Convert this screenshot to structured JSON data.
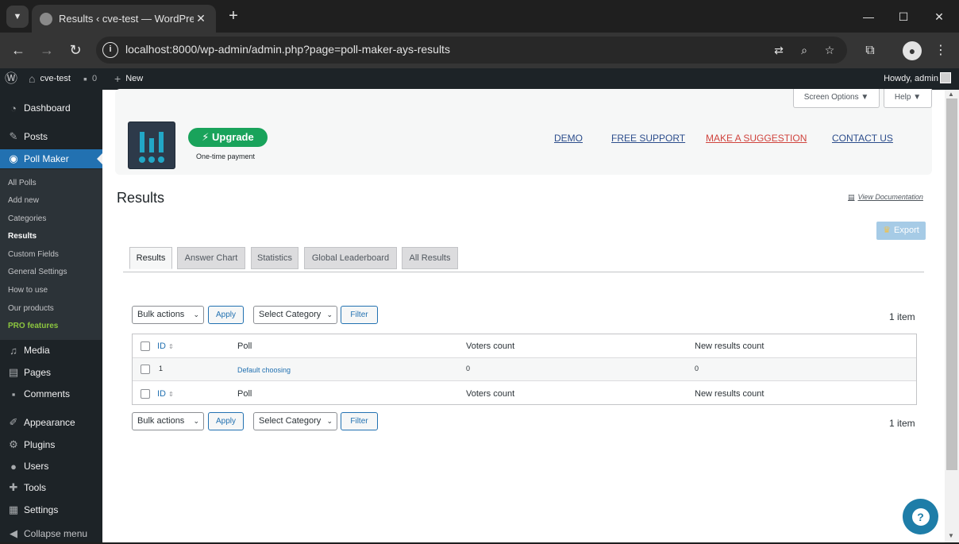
{
  "browser": {
    "tab_title": "Results ‹ cve-test — WordPress",
    "url": "localhost:8000/wp-admin/admin.php?page=poll-maker-ays-results"
  },
  "adminbar": {
    "site_name": "cve-test",
    "comments_count": "0",
    "new_label": "New",
    "howdy": "Howdy, admin"
  },
  "sidebar": {
    "dashboard": "Dashboard",
    "posts": "Posts",
    "poll_maker": "Poll Maker",
    "submenu": [
      "All Polls",
      "Add new",
      "Categories",
      "Results",
      "Custom Fields",
      "General Settings",
      "How to use",
      "Our products",
      "PRO features"
    ],
    "media": "Media",
    "pages": "Pages",
    "comments": "Comments",
    "appearance": "Appearance",
    "plugins": "Plugins",
    "users": "Users",
    "tools": "Tools",
    "settings": "Settings",
    "collapse": "Collapse menu"
  },
  "screen_options": {
    "screen": "Screen Options ▼",
    "help": "Help ▼"
  },
  "header": {
    "upgrade": "⚡ Upgrade",
    "one_time": "One-time payment",
    "links": [
      "DEMO",
      "FREE SUPPORT",
      "MAKE A SUGGESTION",
      "CONTACT US"
    ]
  },
  "page": {
    "title": "Results",
    "view_doc": "View Documentation",
    "export": "Export"
  },
  "tabs": [
    "Results",
    "Answer Chart",
    "Statistics",
    "Global Leaderboard",
    "All Results"
  ],
  "filters": {
    "bulk_actions": "Bulk actions",
    "apply": "Apply",
    "select_category": "Select Category",
    "filter": "Filter",
    "items": "1 item"
  },
  "table": {
    "headers": [
      "ID",
      "Poll",
      "Voters count",
      "New results count"
    ],
    "rows": [
      {
        "id": "1",
        "poll": "Default choosing",
        "voters": "0",
        "new_results": "0"
      }
    ]
  }
}
